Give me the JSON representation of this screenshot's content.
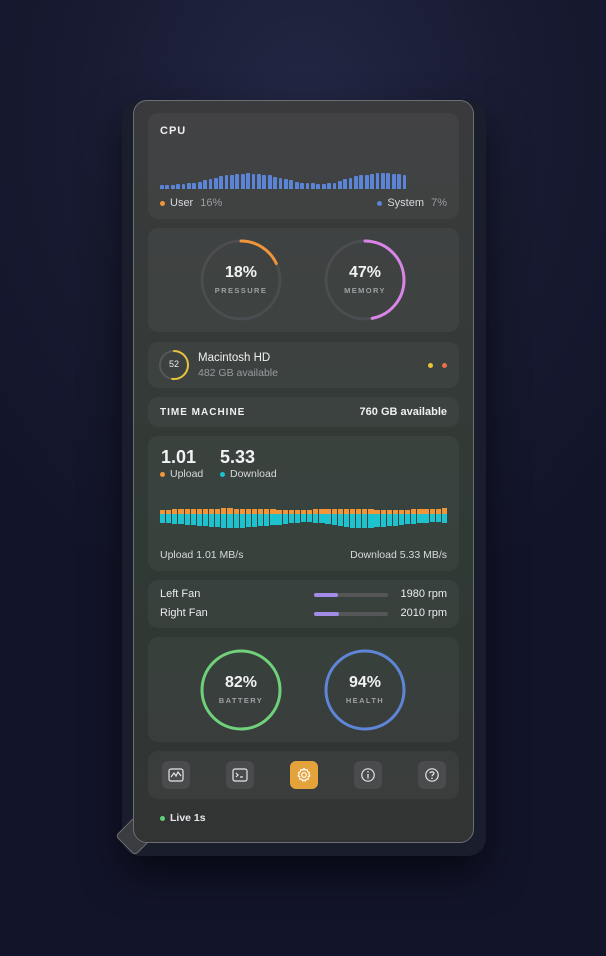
{
  "cpu": {
    "title": "CPU",
    "user_label": "User",
    "user_value": "16%",
    "system_label": "System",
    "system_value": "7%",
    "user_color": "#f0953a",
    "system_color": "#5b84d6",
    "history": [
      0.25,
      0.25,
      0.25,
      0.3,
      0.3,
      0.35,
      0.4,
      0.45,
      0.55,
      0.6,
      0.7,
      0.8,
      0.85,
      0.9,
      0.95,
      0.95,
      1.0,
      0.95,
      0.95,
      0.9,
      0.85,
      0.75,
      0.7,
      0.6,
      0.55,
      0.45,
      0.4,
      0.35,
      0.35,
      0.3,
      0.3,
      0.35,
      0.4,
      0.5,
      0.6,
      0.7,
      0.8,
      0.85,
      0.9,
      0.95,
      1.0,
      1.0,
      1.0,
      0.95,
      0.95,
      0.9
    ]
  },
  "gauges_top": [
    {
      "name": "pressure",
      "value": "18%",
      "label": "PRESSURE",
      "fraction": 0.18,
      "color": "#f0953a"
    },
    {
      "name": "memory",
      "value": "47%",
      "label": "MEMORY",
      "fraction": 0.47,
      "color": "#d985e8"
    }
  ],
  "disk": {
    "badge": "52",
    "fraction": 0.52,
    "name": "Macintosh HD",
    "available": "482 GB available",
    "dot_colors": [
      "#e8c23a",
      "#e8704a"
    ]
  },
  "time_machine": {
    "label": "TIME MACHINE",
    "available": "760 GB available"
  },
  "network": {
    "upload_value": "1.01",
    "download_value": "5.33",
    "upload_label": "Upload",
    "download_label": "Download",
    "upload_color": "#f0953a",
    "download_color": "#1ec2cf",
    "upload_rate": "Upload 1.01 MB/s",
    "download_rate": "Download 5.33 MB/s",
    "up_history": [
      0.6,
      0.6,
      0.65,
      0.7,
      0.7,
      0.75,
      0.8,
      0.8,
      0.85,
      0.85,
      0.9,
      0.9,
      0.85,
      0.85,
      0.8,
      0.8,
      0.75,
      0.7,
      0.65,
      0.6,
      0.55,
      0.5,
      0.5,
      0.55,
      0.6,
      0.65,
      0.7,
      0.75,
      0.8,
      0.85,
      0.85,
      0.8,
      0.75,
      0.7,
      0.65,
      0.6,
      0.55,
      0.5,
      0.5,
      0.55,
      0.6,
      0.65,
      0.7,
      0.75,
      0.8,
      0.85,
      0.9
    ],
    "down_history": [
      0.45,
      0.5,
      0.55,
      0.6,
      0.65,
      0.7,
      0.75,
      0.8,
      0.85,
      0.9,
      0.95,
      1.0,
      1.0,
      0.95,
      0.9,
      0.85,
      0.8,
      0.75,
      0.7,
      0.65,
      0.55,
      0.5,
      0.45,
      0.4,
      0.4,
      0.45,
      0.5,
      0.6,
      0.7,
      0.8,
      0.9,
      0.95,
      1.0,
      1.0,
      0.95,
      0.9,
      0.85,
      0.8,
      0.75,
      0.7,
      0.6,
      0.55,
      0.5,
      0.45,
      0.4,
      0.4,
      0.45
    ]
  },
  "fans": [
    {
      "label": "Left Fan",
      "rpm": "1980 rpm",
      "fraction": 0.33
    },
    {
      "label": "Right Fan",
      "rpm": "2010 rpm",
      "fraction": 0.34
    }
  ],
  "gauges_bottom": [
    {
      "name": "battery",
      "value": "82%",
      "label": "BATTERY",
      "fraction": 1.0,
      "color": "#6fd27a"
    },
    {
      "name": "health",
      "value": "94%",
      "label": "HEALTH",
      "fraction": 1.0,
      "color": "#5f86d6"
    }
  ],
  "toolbar": [
    {
      "name": "activity-icon",
      "active": false
    },
    {
      "name": "terminal-icon",
      "active": false
    },
    {
      "name": "settings-icon",
      "active": true
    },
    {
      "name": "info-icon",
      "active": false
    },
    {
      "name": "help-icon",
      "active": false
    }
  ],
  "status": {
    "live_label": "Live 1s",
    "live_color": "#5fd27a"
  }
}
